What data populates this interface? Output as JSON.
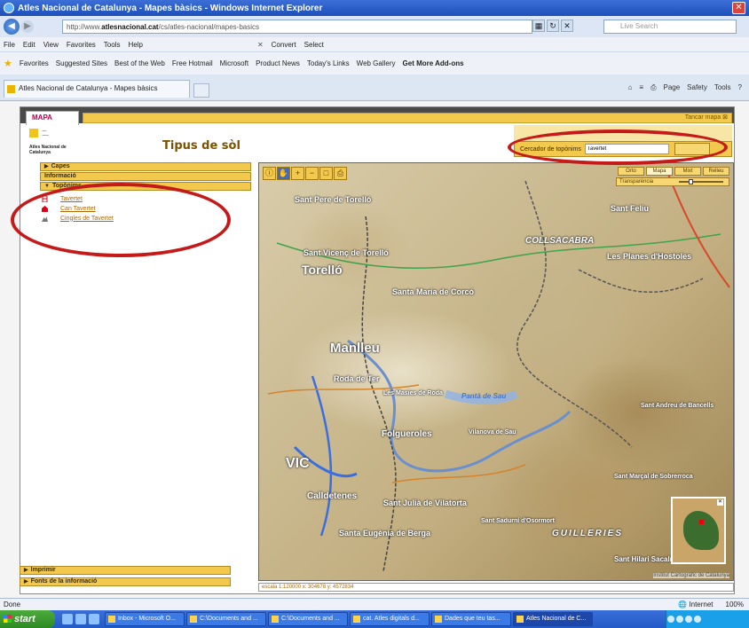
{
  "window": {
    "title": "Atles Nacional de Catalunya - Mapes bàsics - Windows Internet Explorer"
  },
  "address": {
    "url_prefix": "http://www.",
    "url_domain": "atlesnacional.cat",
    "url_rest": "/cs/atles-nacional/mapes-basics",
    "search_placeholder": "Live Search"
  },
  "menu": {
    "items": [
      "File",
      "Edit",
      "View",
      "Favorites",
      "Tools",
      "Help"
    ],
    "convert": "Convert",
    "select": "Select"
  },
  "favorites": {
    "label": "Favorites",
    "items": [
      "Suggested Sites",
      "Best of the Web",
      "Free Hotmail",
      "Microsoft",
      "Product News",
      "Today's Links",
      "Web Gallery"
    ],
    "addons": "Get More Add-ons"
  },
  "tab": {
    "label": "Atles Nacional de Catalunya - Mapes bàsics"
  },
  "cmdbar": {
    "items": [
      "Page",
      "Safety",
      "Tools"
    ]
  },
  "app": {
    "tab_label": "MAPA",
    "close_label": "Tancar mapa",
    "logo_lines": "Atles Nacional de Catalunya",
    "page_title": "Tipus de sòl",
    "search_label": "Cercador de topònims",
    "search_value": "Tavertet"
  },
  "left": {
    "sections": [
      {
        "label": "Capes",
        "expanded": false
      },
      {
        "label": "Informació",
        "expanded": null
      },
      {
        "label": "Topònims",
        "expanded": true
      }
    ],
    "toponyms": [
      "Tavertet",
      "Can Tavertet",
      "Cingles de Tavertet"
    ],
    "bottom_sections": [
      "Imprimir",
      "Fonts de la informació"
    ]
  },
  "map": {
    "view_buttons": [
      "Orto",
      "Mapa",
      "Mixt",
      "Relleu"
    ],
    "selected_view": "Mapa",
    "transparency_label": "Transparència",
    "transparency_level": 0.4,
    "places": [
      "Sant Pere de Torelló",
      "Sant Vicenç de Torelló",
      "Torelló",
      "Santa Maria de Corcó",
      "Manlleu",
      "Roda de Ter",
      "Les Masies de Roda",
      "Pantà de Sau",
      "VIC",
      "Folgueroles",
      "Calldetenes",
      "Sant Julià de Vilatorta",
      "Santa Eugènia de Berga",
      "Sant Feliu",
      "COLLSACABRA",
      "Les Planes d'Hostoles",
      "Sant Sadurní d'Osormort",
      "Sant Marçal de Sobrerroca",
      "GUILLERIES",
      "Sant Hilari Sacalm",
      "Vilanova de Sau",
      "Sant Andreu de Bancells"
    ],
    "copyright": "Institut Cartogràfic de Catalunya",
    "scale_text": "escala 1:120000  x: 304678  y: 4572834"
  },
  "status": {
    "left": "Done",
    "zone": "Internet",
    "zoom": "100%"
  },
  "taskbar": {
    "start": "start",
    "tasks": [
      "Inbox - Microsoft O...",
      "C:\\Documents and ...",
      "C:\\Documents and ...",
      "cat. Atles digitals d...",
      "Dades que teu tas...",
      "Atles Nacional de C..."
    ]
  },
  "colors": {
    "accent": "#f2c94c",
    "highlight": "#c51a1a",
    "link": "#b06800"
  }
}
